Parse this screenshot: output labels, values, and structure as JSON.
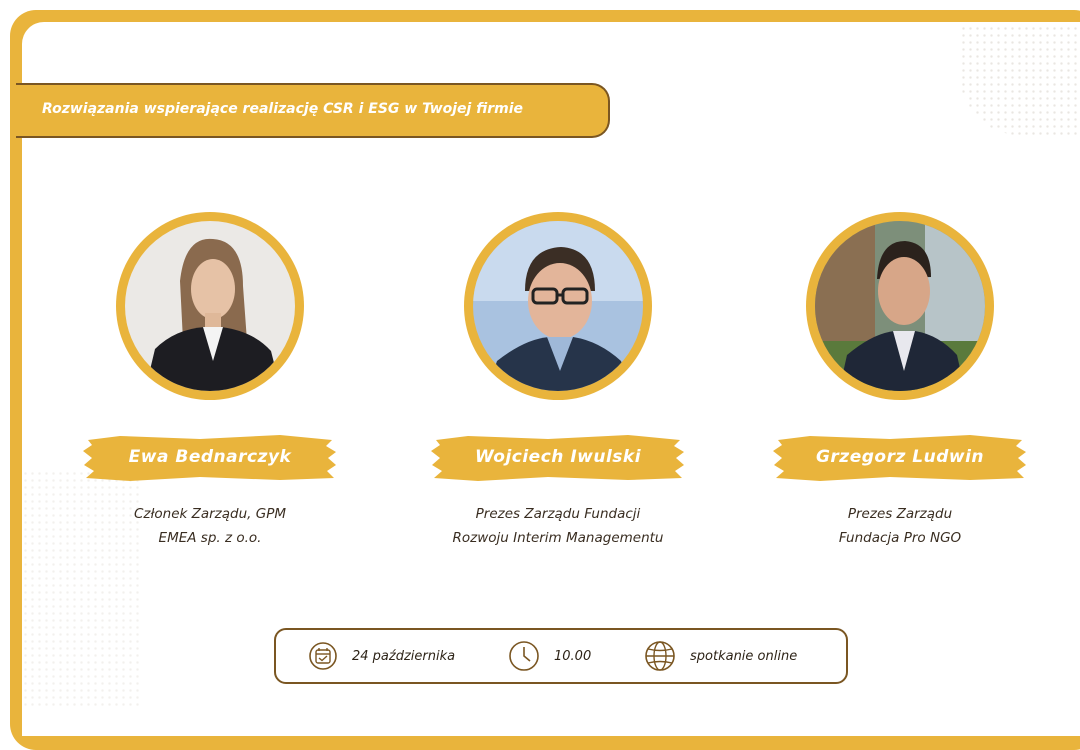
{
  "banner": {
    "title": "Rozwiązania wspierające realizację CSR i ESG w Twojej firmie"
  },
  "speakers": [
    {
      "name": "Ewa Bednarczyk",
      "role_line1": "Członek Zarządu, GPM",
      "role_line2": "EMEA sp. z o.o."
    },
    {
      "name": "Wojciech Iwulski",
      "role_line1": "Prezes Zarządu Fundacji",
      "role_line2": "Rozwoju Interim Managementu"
    },
    {
      "name": "Grzegorz Ludwin",
      "role_line1": "Prezes Zarządu",
      "role_line2": "Fundacja Pro NGO"
    }
  ],
  "event": {
    "date": "24 października",
    "time": "10.00",
    "format": "spotkanie online"
  },
  "icons": {
    "date": "calendar-icon",
    "time": "clock-icon",
    "format": "globe-icon"
  },
  "colors": {
    "accent": "#e9b43c",
    "outline": "#7a5622",
    "text": "#3a2e22",
    "background": "#ffffff"
  }
}
